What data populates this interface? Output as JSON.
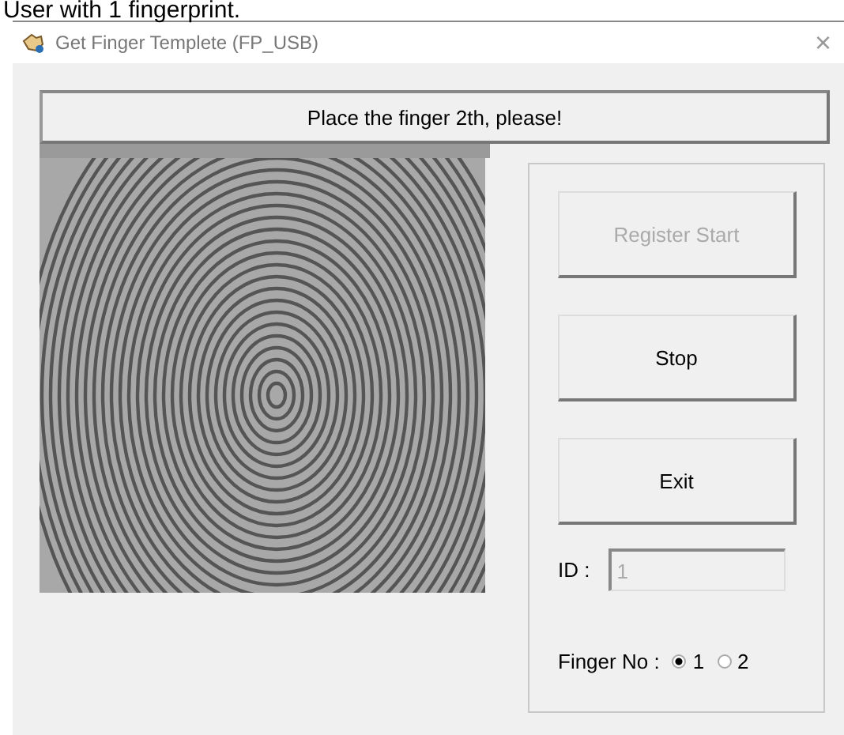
{
  "caption": "User with 1 fingerprint.",
  "window": {
    "title": "Get Finger Templete (FP_USB)",
    "close": "×"
  },
  "status_message": "Place the finger 2th, please!",
  "buttons": [
    {
      "label": "Register Start",
      "disabled": true
    },
    {
      "label": "Stop",
      "disabled": false
    },
    {
      "label": "Exit",
      "disabled": false
    }
  ],
  "id_field": {
    "label": "ID :",
    "value": "1",
    "disabled": true
  },
  "finger_no": {
    "label": "Finger No :",
    "options": [
      {
        "label": "1",
        "selected": true
      },
      {
        "label": "2",
        "selected": false
      }
    ]
  }
}
